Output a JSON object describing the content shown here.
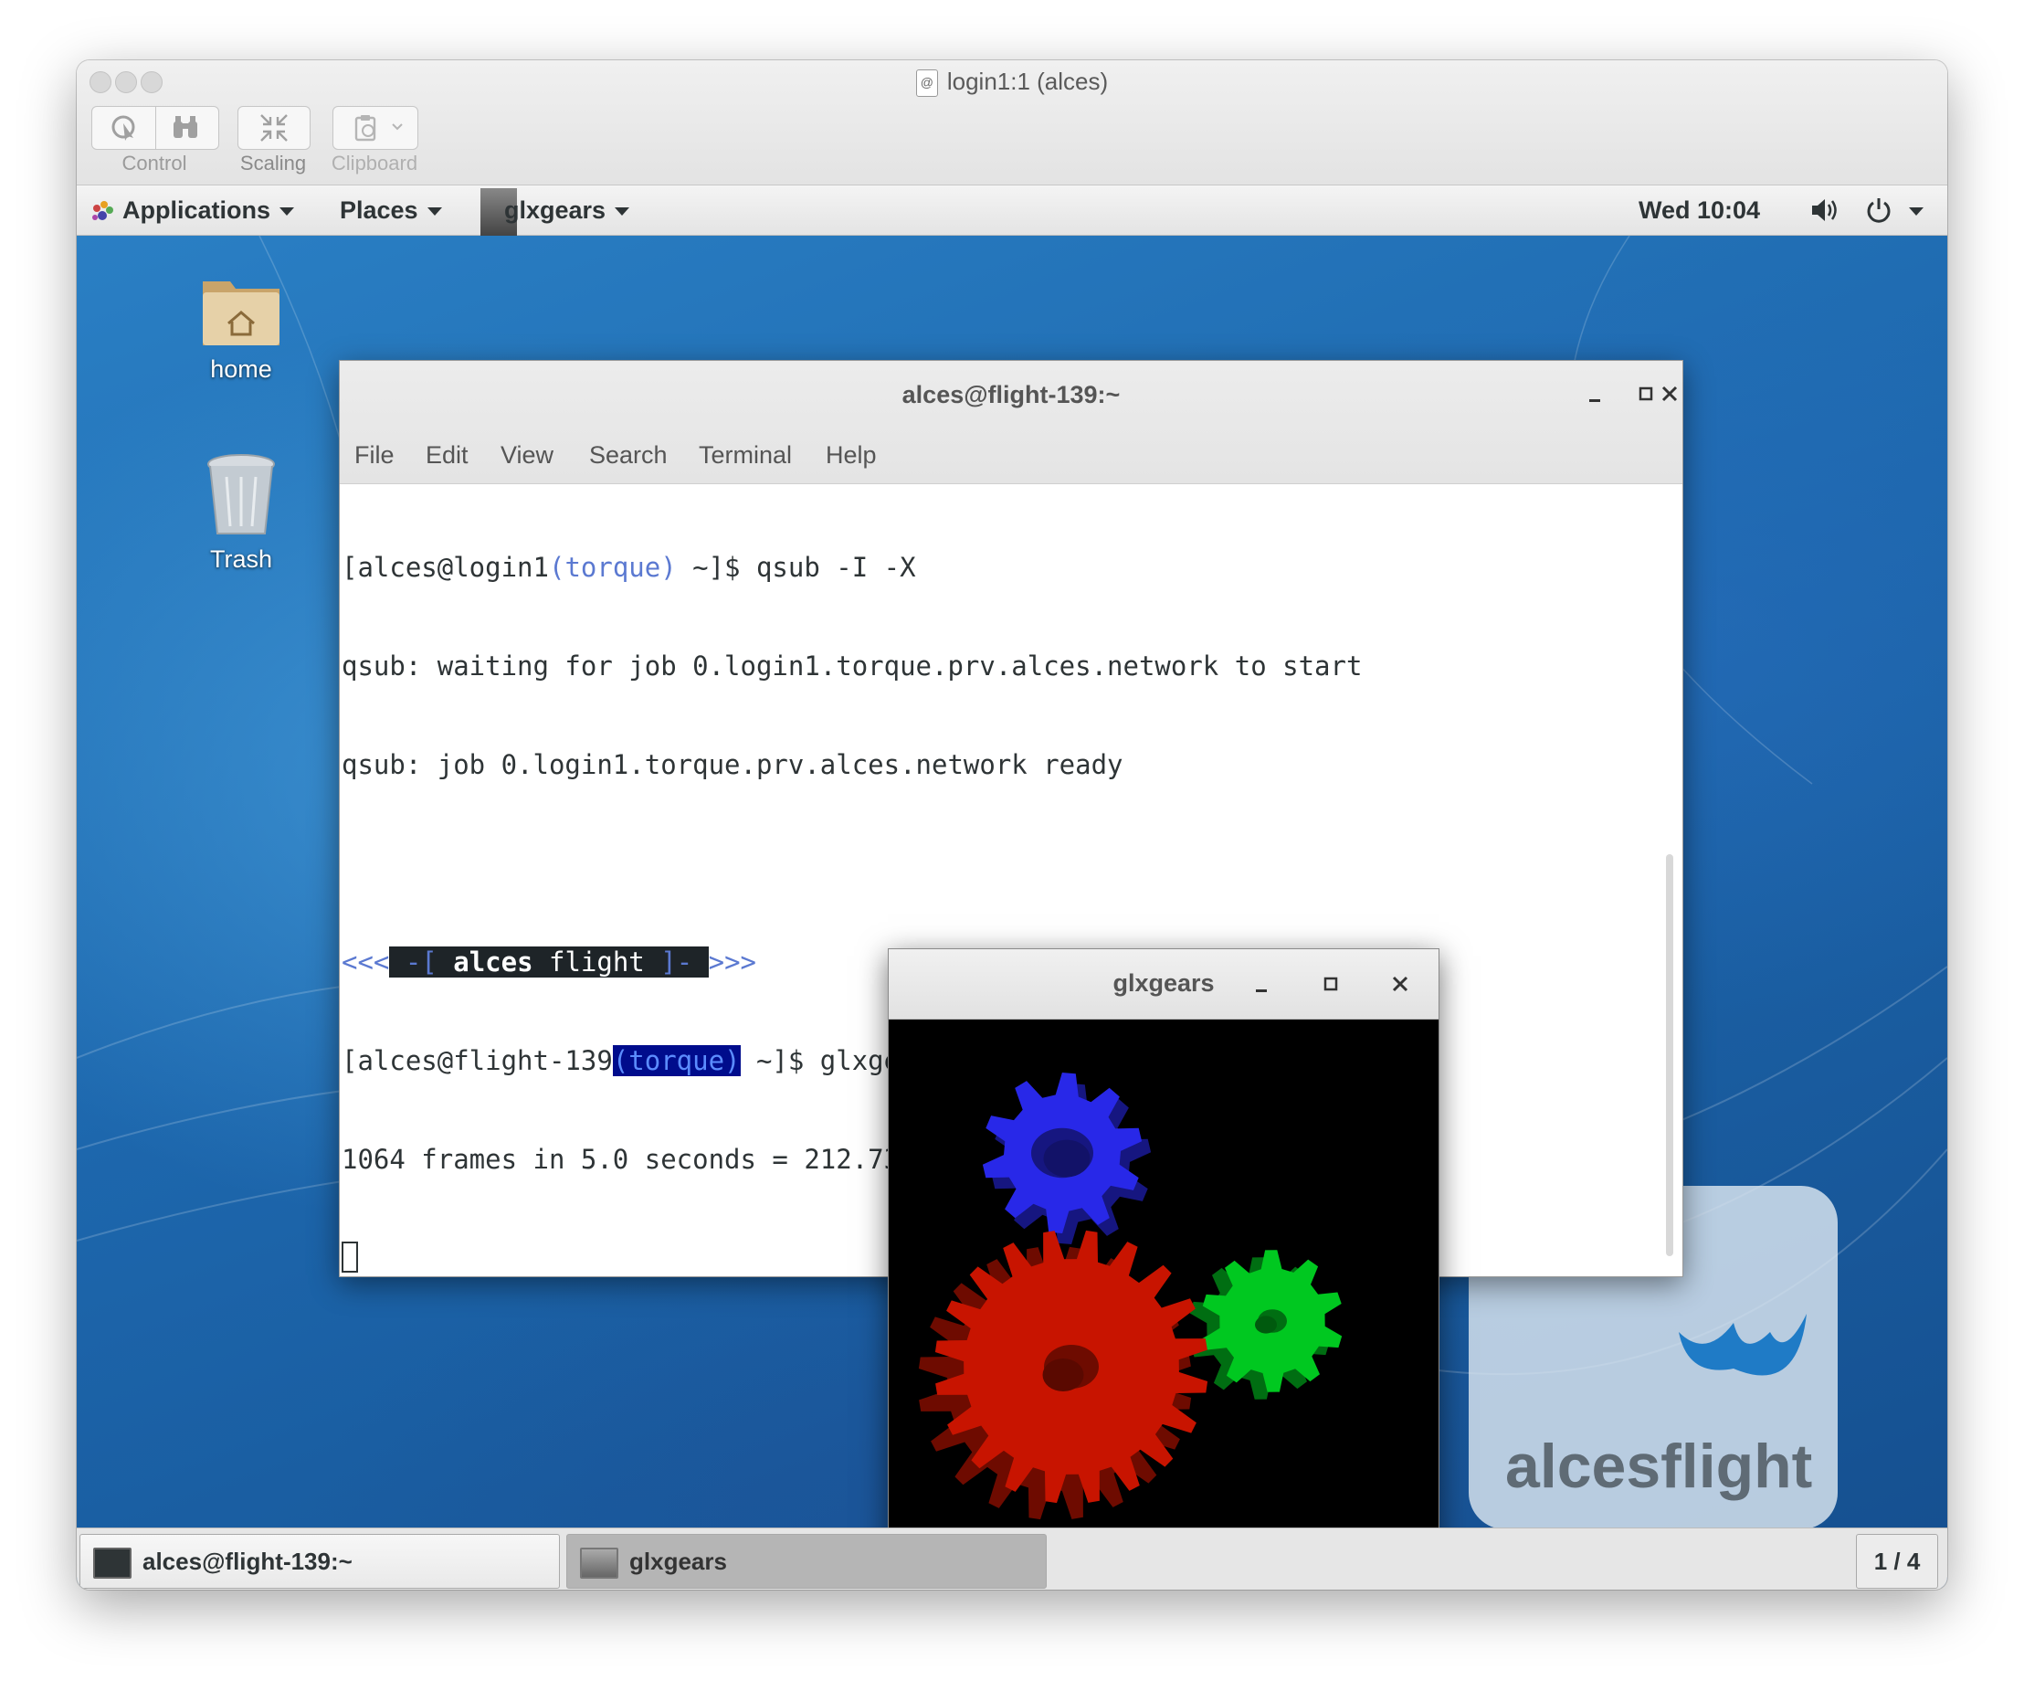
{
  "window": {
    "title": "login1:1 (alces)",
    "vnc_icon": "vnc-icon"
  },
  "toolbar": {
    "control_label": "Control",
    "scaling_label": "Scaling",
    "clipboard_label": "Clipboard"
  },
  "top_panel": {
    "applications": "Applications",
    "places": "Places",
    "active_app": "glxgears",
    "clock": "Wed 10:04"
  },
  "desktop": {
    "icons": [
      {
        "label": "home",
        "icon": "folder-home-icon"
      },
      {
        "label": "Trash",
        "icon": "trash-icon"
      }
    ],
    "logo_text": "alcesflight"
  },
  "terminal": {
    "title": "alces@flight-139:~",
    "menu": [
      "File",
      "Edit",
      "View",
      "Search",
      "Terminal",
      "Help"
    ],
    "lines": {
      "l1_prefix": "[alces@login1",
      "l1_env": "(torque)",
      "l1_cmd": " ~]$ qsub -I -X",
      "l2": "qsub: waiting for job 0.login1.torque.prv.alces.network to start",
      "l3": "qsub: job 0.login1.torque.prv.alces.network ready",
      "banner_left": "<<<",
      "banner_open": " -[ ",
      "banner_bold": "alces",
      "banner_text": " flight ",
      "banner_close": "]- ",
      "banner_right": ">>>",
      "l5_prefix": "[alces@flight-139",
      "l5_env": "(torque)",
      "l5_cmd": " ~]$ glxgears",
      "l6": "1064 frames in 5.0 seconds = 212.730 FPS"
    }
  },
  "glxgears": {
    "title": "glxgears",
    "gear_colors": {
      "red": "#c81400",
      "green": "#00c820",
      "blue": "#2828e8"
    }
  },
  "taskbar": {
    "items": [
      {
        "label": "alces@flight-139:~",
        "icon": "terminal-icon"
      },
      {
        "label": "glxgears",
        "icon": "window-icon"
      }
    ],
    "workspace": "1 / 4"
  }
}
